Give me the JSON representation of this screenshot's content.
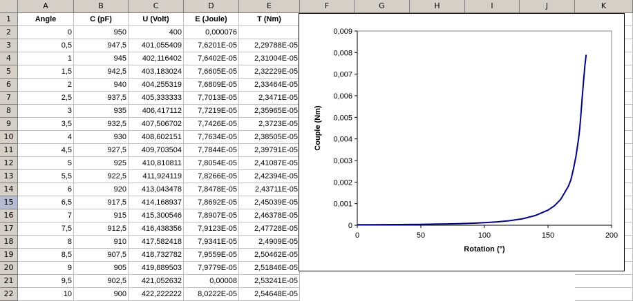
{
  "sheet": {
    "columns": [
      "A",
      "B",
      "C",
      "D",
      "E",
      "F",
      "G",
      "H",
      "I",
      "J",
      "K"
    ],
    "selected_row": "15",
    "row_numbers": [
      "1",
      "2",
      "3",
      "4",
      "5",
      "6",
      "7",
      "8",
      "9",
      "10",
      "11",
      "12",
      "13",
      "14",
      "15",
      "16",
      "17",
      "18",
      "19",
      "20",
      "21",
      "22"
    ],
    "header_row": [
      "Angle",
      "C (pF)",
      "U (Volt)",
      "E (Joule)",
      "T (Nm)"
    ],
    "rows": [
      [
        "0",
        "950",
        "400",
        "0,000076",
        ""
      ],
      [
        "0,5",
        "947,5",
        "401,055409",
        "7,6201E-05",
        "2,29788E-05"
      ],
      [
        "1",
        "945",
        "402,116402",
        "7,6402E-05",
        "2,31004E-05"
      ],
      [
        "1,5",
        "942,5",
        "403,183024",
        "7,6605E-05",
        "2,32229E-05"
      ],
      [
        "2",
        "940",
        "404,255319",
        "7,6809E-05",
        "2,33464E-05"
      ],
      [
        "2,5",
        "937,5",
        "405,333333",
        "7,7013E-05",
        "2,3471E-05"
      ],
      [
        "3",
        "935",
        "406,417112",
        "7,7219E-05",
        "2,35965E-05"
      ],
      [
        "3,5",
        "932,5",
        "407,506702",
        "7,7426E-05",
        "2,3723E-05"
      ],
      [
        "4",
        "930",
        "408,602151",
        "7,7634E-05",
        "2,38505E-05"
      ],
      [
        "4,5",
        "927,5",
        "409,703504",
        "7,7844E-05",
        "2,39791E-05"
      ],
      [
        "5",
        "925",
        "410,810811",
        "7,8054E-05",
        "2,41087E-05"
      ],
      [
        "5,5",
        "922,5",
        "411,924119",
        "7,8266E-05",
        "2,42394E-05"
      ],
      [
        "6",
        "920",
        "413,043478",
        "7,8478E-05",
        "2,43711E-05"
      ],
      [
        "6,5",
        "917,5",
        "414,168937",
        "7,8692E-05",
        "2,45039E-05"
      ],
      [
        "7",
        "915",
        "415,300546",
        "7,8907E-05",
        "2,46378E-05"
      ],
      [
        "7,5",
        "912,5",
        "416,438356",
        "7,9123E-05",
        "2,47728E-05"
      ],
      [
        "8",
        "910",
        "417,582418",
        "7,9341E-05",
        "2,4909E-05"
      ],
      [
        "8,5",
        "907,5",
        "418,732782",
        "7,9559E-05",
        "2,50462E-05"
      ],
      [
        "9",
        "905",
        "419,889503",
        "7,9779E-05",
        "2,51846E-05"
      ],
      [
        "9,5",
        "902,5",
        "421,052632",
        "0,00008",
        "2,53241E-05"
      ],
      [
        "10",
        "900",
        "422,222222",
        "8,0222E-05",
        "2,54648E-05"
      ]
    ]
  },
  "chart_data": {
    "type": "line",
    "xlabel": "Rotation (°)",
    "ylabel": "Couple (Nm)",
    "xlim": [
      0,
      200
    ],
    "ylim": [
      0,
      0.009
    ],
    "x_ticks": [
      "0",
      "50",
      "100",
      "150",
      "200"
    ],
    "y_ticks": [
      "0",
      "0,001",
      "0,002",
      "0,003",
      "0,004",
      "0,005",
      "0,006",
      "0,007",
      "0,008",
      "0,009"
    ],
    "line_color": "#000080",
    "grid": false,
    "series": [
      {
        "x": [
          0,
          10,
          20,
          30,
          40,
          50,
          60,
          70,
          80,
          90,
          100,
          110,
          120,
          130,
          140,
          150,
          155,
          160,
          163,
          166,
          168,
          170,
          172,
          174,
          175,
          176,
          177,
          178,
          179,
          180
        ],
        "values": [
          2.3e-05,
          2.5e-05,
          2.8e-05,
          3.2e-05,
          3.6e-05,
          4.2e-05,
          5e-05,
          6e-05,
          7.4e-05,
          9.2e-05,
          0.000118,
          0.000155,
          0.00021,
          0.0003,
          0.00045,
          0.0007,
          0.0009,
          0.0012,
          0.0015,
          0.0018,
          0.0021,
          0.0026,
          0.0032,
          0.004,
          0.0045,
          0.0052,
          0.006,
          0.0067,
          0.0074,
          0.0079
        ]
      }
    ]
  }
}
